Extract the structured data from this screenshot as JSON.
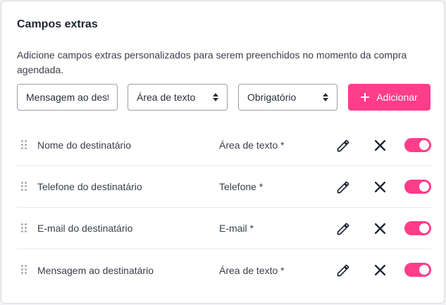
{
  "section": {
    "title": "Campos extras",
    "description": "Adicione campos extras personalizados para serem preenchidos no momento da compra agendada."
  },
  "form": {
    "name_value": "Mensagem ao destinatário",
    "type_select": {
      "value": "Área de texto"
    },
    "required_select": {
      "value": "Obrigatório"
    },
    "add_label": "Adicionar"
  },
  "fields": [
    {
      "name": "Nome do destinatário",
      "type": "Área de texto *",
      "enabled": true
    },
    {
      "name": "Telefone do destinatário",
      "type": "Telefone *",
      "enabled": true
    },
    {
      "name": "E-mail do destinatário",
      "type": "E-mail *",
      "enabled": true
    },
    {
      "name": "Mensagem ao destinatário",
      "type": "Área de texto *",
      "enabled": true
    }
  ],
  "colors": {
    "accent": "#ff3d8b",
    "text": "#3a3f4a",
    "border": "#9aa0aa"
  },
  "icons": {
    "edit": "pencil-icon",
    "delete": "close-icon",
    "drag": "drag-handle-icon",
    "add": "plus-icon"
  }
}
